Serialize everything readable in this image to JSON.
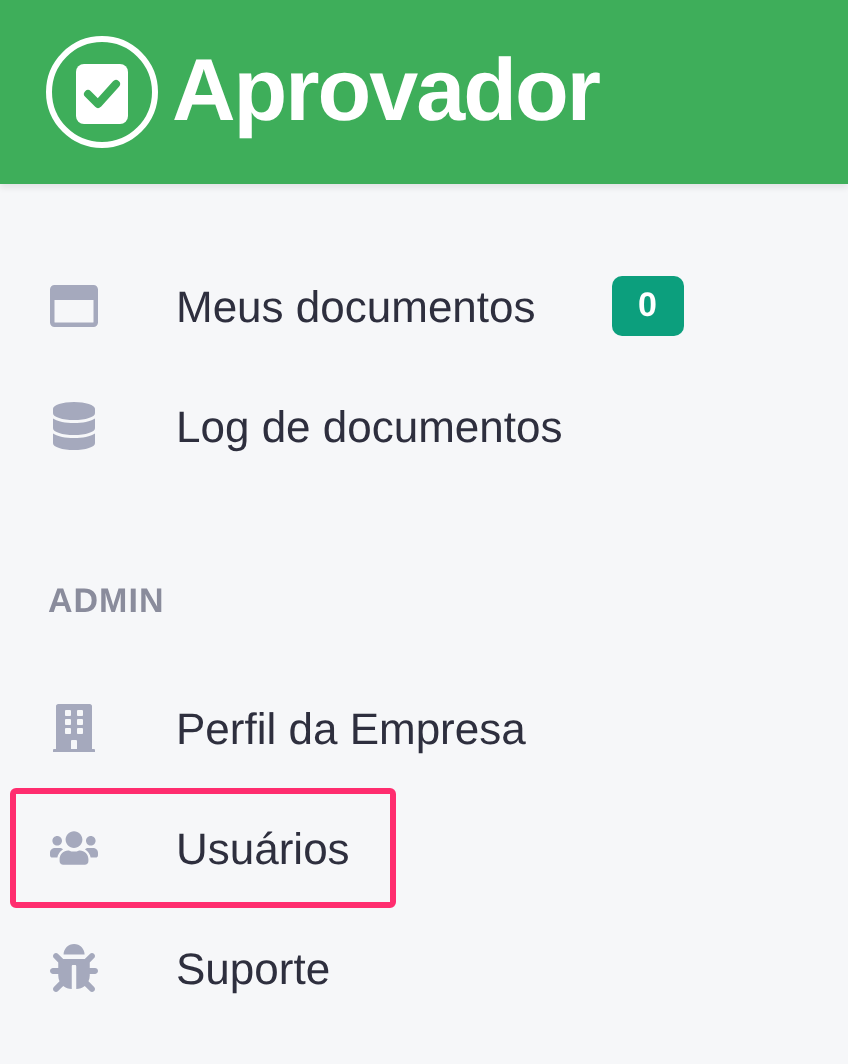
{
  "header": {
    "title": "Aprovador"
  },
  "main_nav": [
    {
      "label": "Meus documentos",
      "badge": "0",
      "highlighted": false
    },
    {
      "label": "Log de documentos",
      "highlighted": false
    }
  ],
  "admin_section": {
    "heading": "ADMIN",
    "items": [
      {
        "label": "Perfil da Empresa",
        "highlighted": false
      },
      {
        "label": "Usuários",
        "highlighted": true
      },
      {
        "label": "Suporte",
        "highlighted": false
      }
    ]
  }
}
